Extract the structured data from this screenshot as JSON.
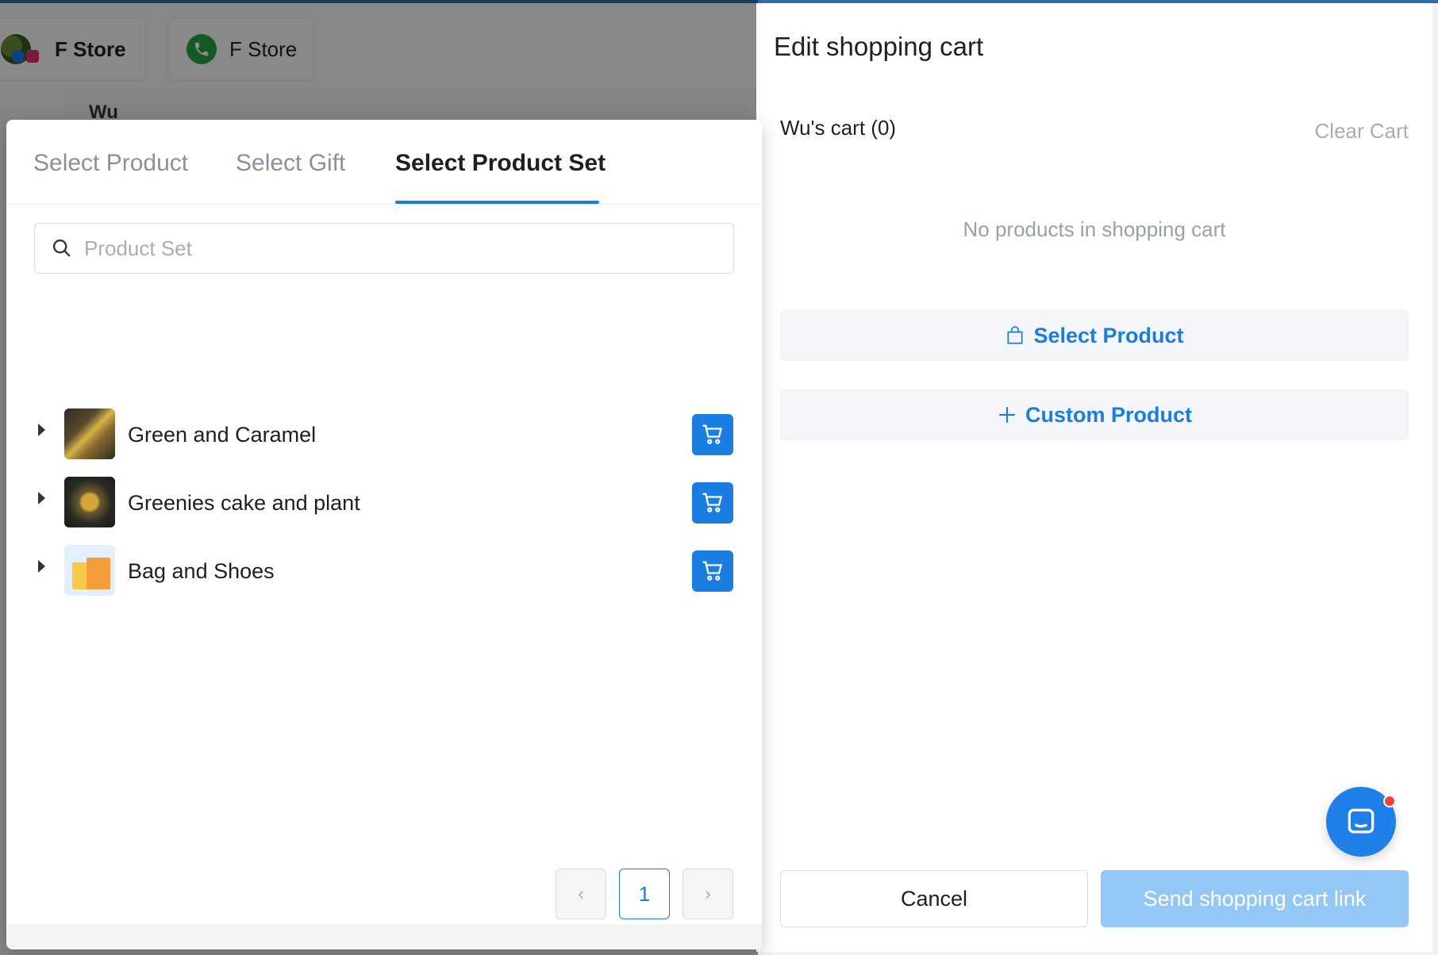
{
  "background": {
    "stores": [
      {
        "label": "F Store",
        "icon": "social-avatar-icon"
      },
      {
        "label": "F Store",
        "icon": "whatsapp-icon"
      }
    ],
    "contact_name": "Wu"
  },
  "panel": {
    "tabs": [
      {
        "label": "Select Product"
      },
      {
        "label": "Select Gift"
      },
      {
        "label": "Select Product Set",
        "active": true
      }
    ],
    "search_placeholder": "Product Set",
    "product_sets": [
      {
        "name": "Green and Caramel",
        "thumb": "food-photo"
      },
      {
        "name": "Greenies cake and plant",
        "thumb": "leaf-photo"
      },
      {
        "name": "Bag and Shoes",
        "thumb": "shopping-bag-illustration"
      }
    ],
    "pagination": {
      "prev": "‹",
      "current": "1",
      "next": "›"
    }
  },
  "drawer": {
    "title": "Edit shopping cart",
    "cart_label": "Wu's cart (0)",
    "clear_cart": "Clear Cart",
    "empty_message": "No products in shopping cart",
    "select_product": "Select Product",
    "custom_product": "Custom Product",
    "cancel": "Cancel",
    "send": "Send shopping cart link"
  },
  "colors": {
    "accent": "#1a7de0",
    "send_disabled": "#93c8f6",
    "notification": "#f5413a"
  }
}
